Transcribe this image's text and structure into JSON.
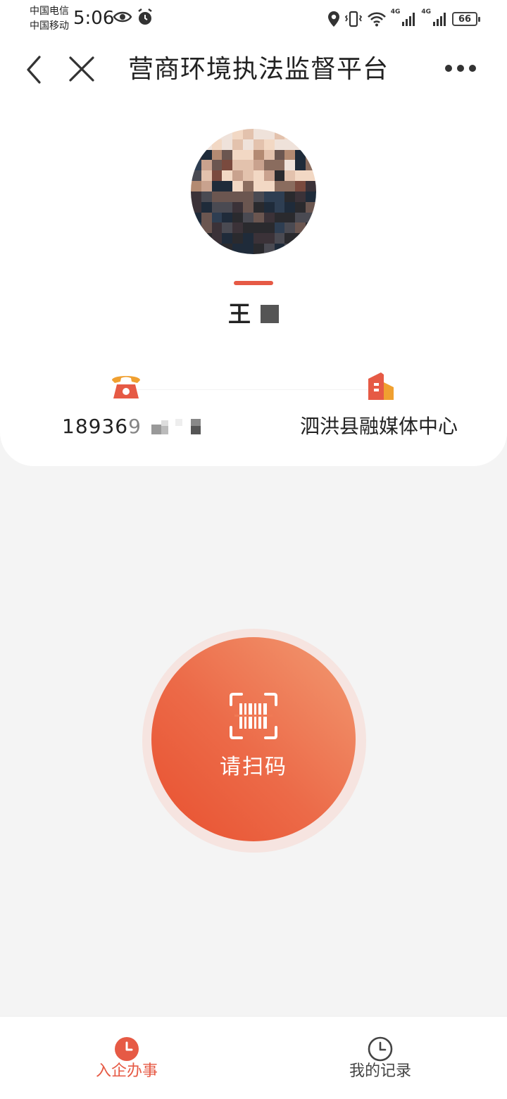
{
  "status_bar": {
    "carrier_1": "中国电信",
    "carrier_2": "中国移动",
    "time": "5:06",
    "network_1": "4G",
    "network_2": "4G",
    "battery": "66",
    "icons": [
      "eye-icon",
      "alarm-icon",
      "location-icon",
      "vibrate-icon",
      "wifi-icon",
      "signal-icon",
      "battery-icon"
    ]
  },
  "navbar": {
    "title": "营商环境执法监督平台",
    "icons": [
      "back-icon",
      "close-icon",
      "more-icon"
    ]
  },
  "profile": {
    "name": "王",
    "phone": "18936",
    "phone_partial_digit": "9",
    "organization": "泗洪县融媒体中心",
    "icons": [
      "phone-icon",
      "building-icon"
    ]
  },
  "scan": {
    "label": "请扫码",
    "icon": "barcode-scan-icon"
  },
  "tabs": [
    {
      "label": "入企办事",
      "icon": "clock-filled-icon",
      "active": true
    },
    {
      "label": "我的记录",
      "icon": "clock-outline-icon",
      "active": false
    }
  ],
  "colors": {
    "accent": "#e65a45",
    "scan_gradient_light": "#f29a72",
    "scan_gradient_dark": "#e8502f",
    "background": "#f4f4f4"
  }
}
